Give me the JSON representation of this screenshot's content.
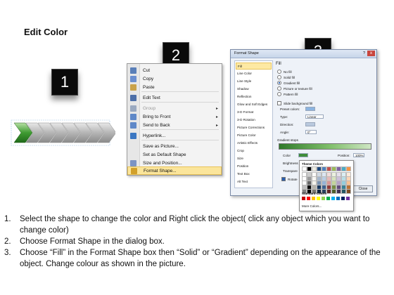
{
  "title": "Edit Color",
  "badges": [
    "1",
    "2",
    "3"
  ],
  "context_menu": {
    "items": [
      {
        "label": "Cut",
        "icon": "scissors-icon",
        "color": "#5a7fb8"
      },
      {
        "label": "Copy",
        "icon": "copy-icon",
        "color": "#6b8fd0"
      },
      {
        "label": "Paste",
        "icon": "clipboard-icon",
        "color": "#c9a24a"
      },
      {
        "label": "Edit Text",
        "icon": "edit-text-icon",
        "color": "#4d6fa8"
      },
      {
        "label": "Group",
        "icon": "group-icon",
        "color": "#9aa9c0",
        "disabled": true,
        "submenu": true
      },
      {
        "label": "Bring to Front",
        "icon": "bring-front-icon",
        "color": "#5f88c8",
        "submenu": true
      },
      {
        "label": "Send to Back",
        "icon": "send-back-icon",
        "color": "#5f88c8",
        "submenu": true
      },
      {
        "label": "Hyperlink...",
        "icon": "globe-icon",
        "color": "#3b77c2"
      },
      {
        "label": "Save as Picture...",
        "icon": "none",
        "color": "transparent"
      },
      {
        "label": "Set as Default Shape",
        "icon": "none",
        "color": "transparent"
      },
      {
        "label": "Size and Position...",
        "icon": "size-icon",
        "color": "#7c94c4"
      },
      {
        "label": "Format Shape...",
        "icon": "format-shape-icon",
        "color": "#d2a02a",
        "highlighted": true
      }
    ]
  },
  "dialog": {
    "title": "Format Shape",
    "help": "?",
    "close_x": "x",
    "categories": [
      "Fill",
      "Line Color",
      "Line Style",
      "Shadow",
      "Reflection",
      "Glow and Soft Edges",
      "3-D Format",
      "3-D Rotation",
      "Picture Corrections",
      "Picture Color",
      "Artistic Effects",
      "Crop",
      "Size",
      "Position",
      "Text Box",
      "Alt Text"
    ],
    "selected_category": 0,
    "pane_heading": "Fill",
    "fill_options": [
      {
        "label": "No fill",
        "selected": false
      },
      {
        "label": "Solid fill",
        "selected": false
      },
      {
        "label": "Gradient fill",
        "selected": true
      },
      {
        "label": "Picture or texture fill",
        "selected": false
      },
      {
        "label": "Pattern fill",
        "selected": false
      }
    ],
    "slide_background": "Slide background fill",
    "preset_label": "Preset colors:",
    "type_label": "Type:",
    "type_value": "Linear",
    "direction_label": "Direction:",
    "angle_label": "Angle:",
    "angle_value": "0°",
    "gradient_stops_label": "Gradient stops",
    "color_label": "Color",
    "position_label": "Position:",
    "position_value": "100%",
    "brightness_label": "Brightness",
    "transparency_label": "Transpare",
    "rotate_label": "Rotate",
    "close_button": "Close"
  },
  "palette": {
    "theme_label": "Theme Colors",
    "standard_label": "Standard Colors",
    "more_label": "More Colors...",
    "theme_columns": [
      "#ffffff",
      "#000000",
      "#eeece1",
      "#1f497d",
      "#4f81bd",
      "#c0504d",
      "#9bbb59",
      "#8064a2",
      "#4bacc6",
      "#f79646"
    ],
    "standard": [
      "#c00000",
      "#ff0000",
      "#ffc000",
      "#ffff00",
      "#92d050",
      "#00b050",
      "#00b0f0",
      "#0070c0",
      "#002060",
      "#7030a0"
    ]
  },
  "steps": [
    {
      "num": "1.",
      "text": "Select the shape to change the color and Right click the object( click any object which you want to change color)"
    },
    {
      "num": "2.",
      "text": "Choose Format Shape in the dialog box."
    },
    {
      "num": "3.",
      "text": "Choose “Fill” in the Format Shape box then “Solid” or “Gradient” depending on the appearance of the object. Change colour as shown in the picture."
    }
  ]
}
